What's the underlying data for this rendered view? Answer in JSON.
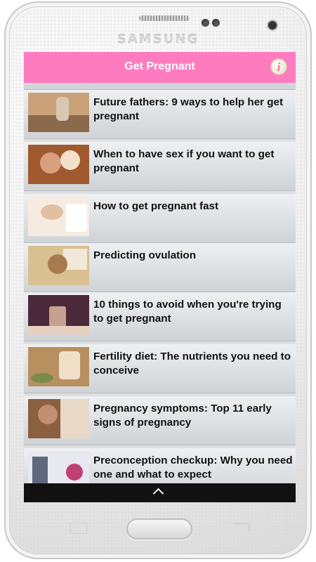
{
  "device": {
    "brand": "SAMSUNG"
  },
  "app": {
    "title": "Get Pregnant",
    "info_label": "i",
    "accent": "#ff7bc0"
  },
  "articles": [
    {
      "title": "Future fathers: 9 ways to help her get pregnant",
      "thumb_colors": [
        "#caa27a",
        "#8a6a4a",
        "#d8c8b0"
      ]
    },
    {
      "title": "When to have sex if you want to get pregnant",
      "thumb_colors": [
        "#a05a30",
        "#d9a080",
        "#f4e0c8"
      ]
    },
    {
      "title": "How to get pregnant fast",
      "thumb_colors": [
        "#f6ebe0",
        "#e0c0a0",
        "#ffffff"
      ]
    },
    {
      "title": "Predicting ovulation",
      "thumb_colors": [
        "#d8c090",
        "#f0e8d8",
        "#a87a50"
      ]
    },
    {
      "title": "10 things to avoid when you're trying to get pregnant",
      "thumb_colors": [
        "#4a2a3a",
        "#c8a090",
        "#e8d0c0"
      ]
    },
    {
      "title": "Fertility diet: The nutrients you need to conceive",
      "thumb_colors": [
        "#b89060",
        "#f0e0c8",
        "#7a8a4a"
      ]
    },
    {
      "title": "Pregnancy symptoms: Top 11 early signs of pregnancy",
      "thumb_colors": [
        "#8a6040",
        "#e8d8c8",
        "#c09070"
      ]
    },
    {
      "title": "Preconception checkup: Why you need one and what to expect",
      "thumb_colors": [
        "#c04070",
        "#e8e8f0",
        "#606880"
      ]
    }
  ],
  "footer": {
    "icon": "chevron-up-icon"
  }
}
